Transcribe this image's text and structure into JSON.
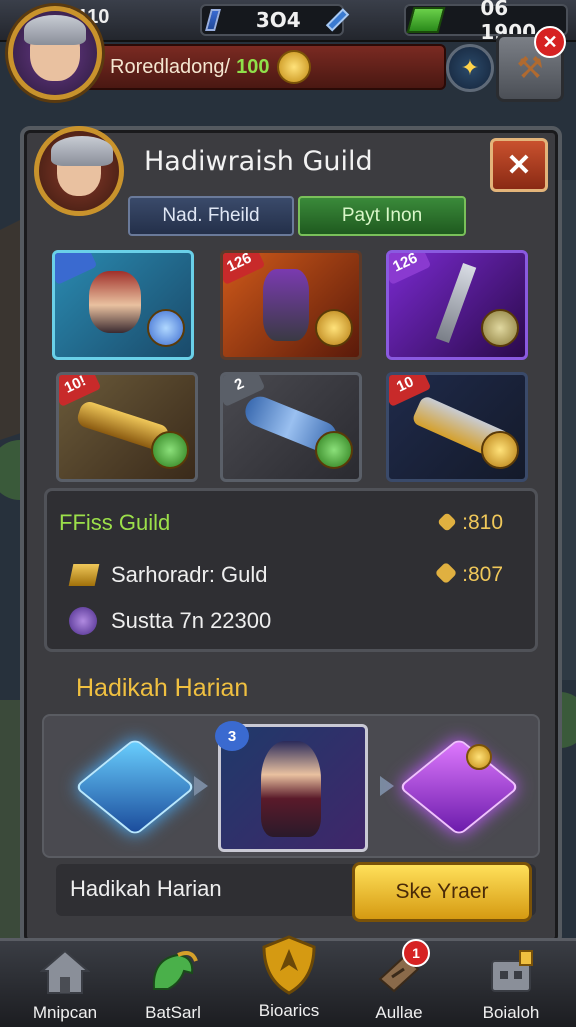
{
  "topbar": {
    "level": "/ 110",
    "currency1": "3O4",
    "currency2": "06 1900"
  },
  "player": {
    "name": "Roredladong/",
    "level": "100"
  },
  "panel": {
    "title": "Hadiwraish Guild",
    "close": "✕",
    "tabs": [
      {
        "label": "Nad. Fheild"
      },
      {
        "label": "Payt Inon"
      }
    ]
  },
  "items": [
    {
      "badge": "",
      "emblem_icon": "star"
    },
    {
      "badge": "126",
      "emblem_icon": "coin"
    },
    {
      "badge": "126",
      "emblem_icon": "sword"
    },
    {
      "badge": "10!",
      "emblem_icon": "leaf"
    },
    {
      "badge": "2",
      "emblem_icon": "leaf"
    },
    {
      "badge": "10",
      "emblem_icon": "coin"
    }
  ],
  "stats": {
    "guild_name": "FFiss Guild",
    "guild_value": ":810",
    "row2_label": "Sarhoradr: Guld",
    "row2_value": ":807",
    "row3_label": "Sustta 7n 22300"
  },
  "daily": {
    "title": "Hadikah Harian",
    "hero_badge": "3",
    "row_label": "Hadikah Harian",
    "button_label": "Ske Yraer"
  },
  "nav": [
    {
      "label": "Mnipcan",
      "icon": "house-icon"
    },
    {
      "label": "BatSarl",
      "icon": "dragon-icon"
    },
    {
      "label": "Bioarics",
      "icon": "shield-icon"
    },
    {
      "label": "Aullae",
      "icon": "scroll-icon",
      "notif": "1"
    },
    {
      "label": "Boialoh",
      "icon": "chest-icon"
    }
  ]
}
